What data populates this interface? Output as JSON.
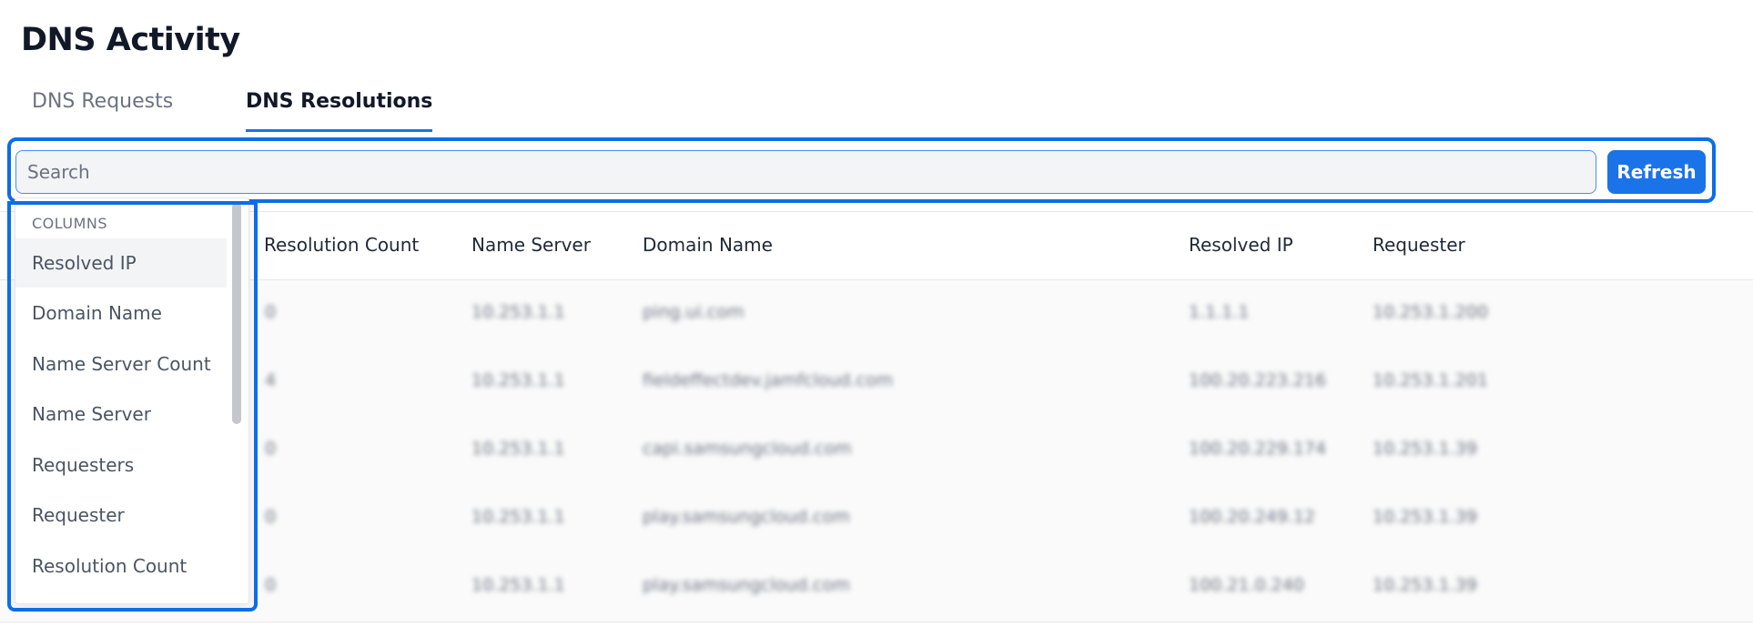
{
  "page": {
    "title": "DNS Activity"
  },
  "tabs": [
    {
      "label": "DNS Requests",
      "active": false
    },
    {
      "label": "DNS Resolutions",
      "active": true
    }
  ],
  "toolbar": {
    "search_placeholder": "Search",
    "refresh_label": "Refresh",
    "highlight_color": "#0b6ee8"
  },
  "table": {
    "columns": [
      "Resolution Count",
      "Name Server",
      "Domain Name",
      "Resolved IP",
      "Requester"
    ],
    "rows": [
      [
        "0",
        "10.253.1.1",
        "ping.ui.com",
        "1.1.1.1",
        "10.253.1.200"
      ],
      [
        "4",
        "10.253.1.1",
        "fieldeffectdev.jamfcloud.com",
        "100.20.223.216",
        "10.253.1.201"
      ],
      [
        "0",
        "10.253.1.1",
        "capi.samsungcloud.com",
        "100.20.229.174",
        "10.253.1.39"
      ],
      [
        "0",
        "10.253.1.1",
        "play.samsungcloud.com",
        "100.20.249.12",
        "10.253.1.39"
      ],
      [
        "0",
        "10.253.1.1",
        "play.samsungcloud.com",
        "100.21.0.240",
        "10.253.1.39"
      ]
    ]
  },
  "columns_menu": {
    "heading": "COLUMNS",
    "items": [
      "Resolved IP",
      "Domain Name",
      "Name Server Count",
      "Name Server",
      "Requesters",
      "Requester",
      "Resolution Count"
    ]
  },
  "colors": {
    "accent": "#1a73e8",
    "text_primary": "#111827",
    "text_secondary": "#6b7280"
  }
}
